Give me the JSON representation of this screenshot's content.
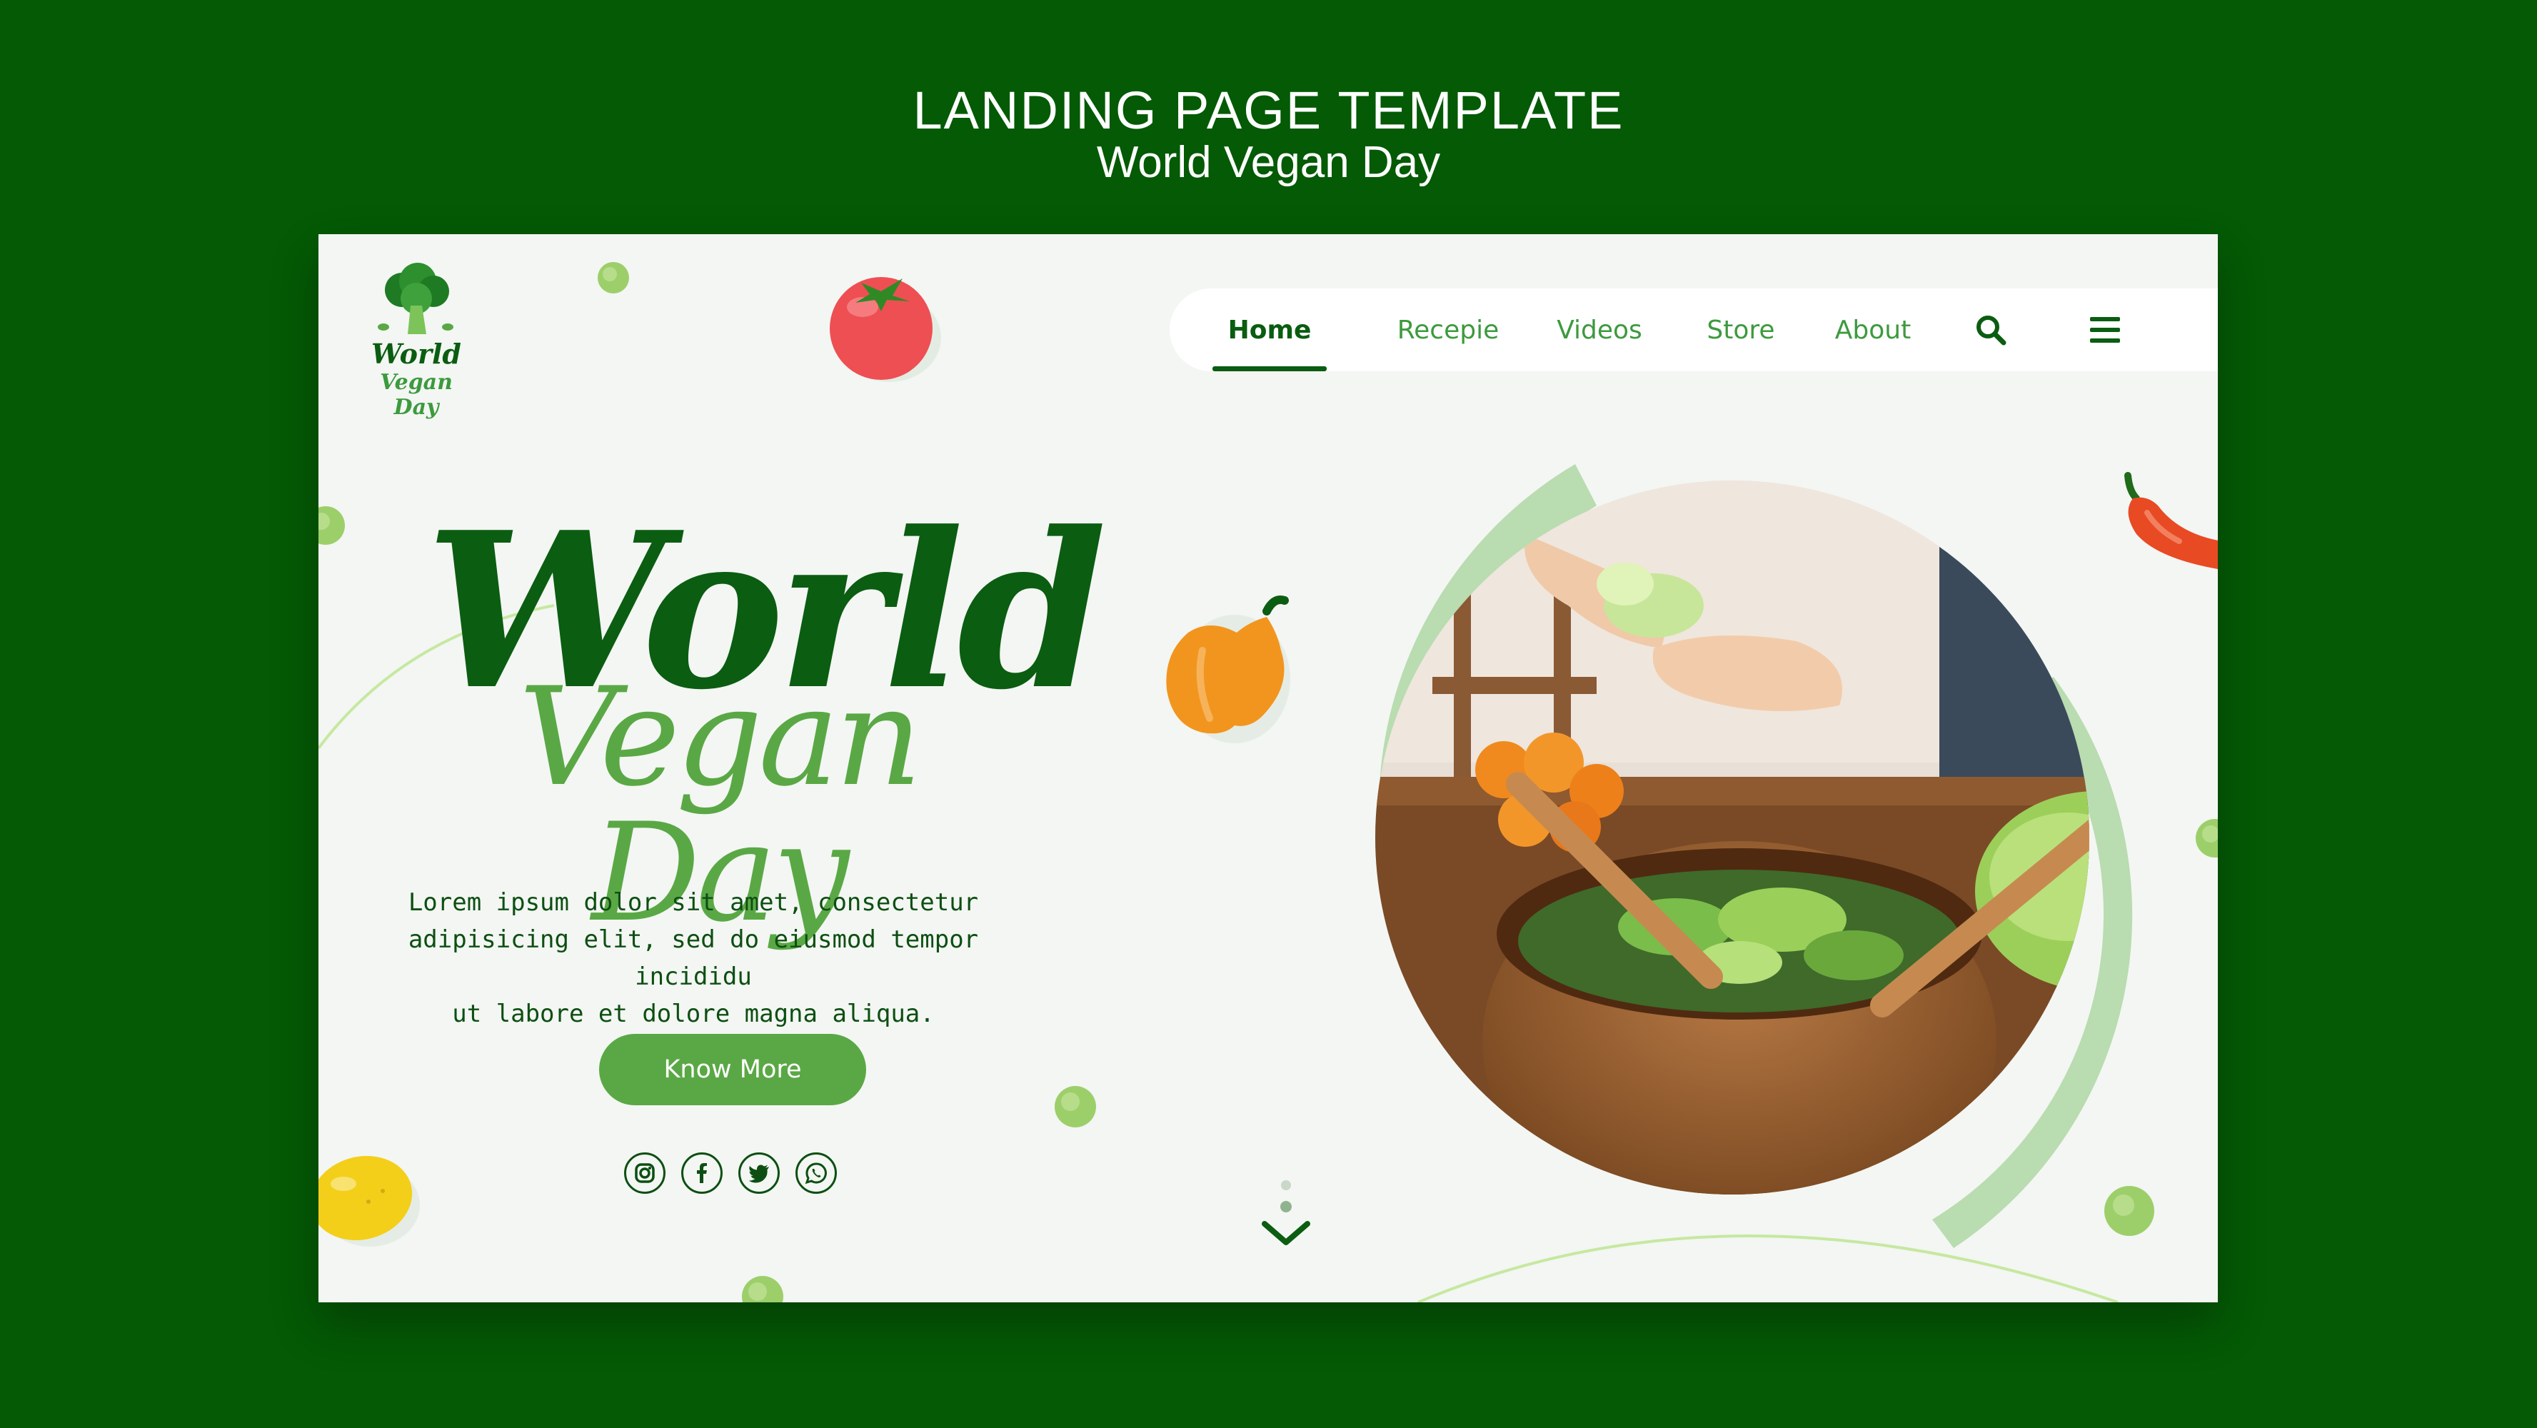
{
  "header": {
    "title": "LANDING PAGE TEMPLATE",
    "subtitle": "World Vegan Day"
  },
  "logo": {
    "line1": "World",
    "line2": "Vegan Day",
    "icon": "broccoli-icon"
  },
  "nav": {
    "items": [
      {
        "label": "Home",
        "active": true
      },
      {
        "label": "Recepie",
        "active": false
      },
      {
        "label": "Videos",
        "active": false
      },
      {
        "label": "Store",
        "active": false
      },
      {
        "label": "About",
        "active": false
      }
    ],
    "search_icon": "search-icon",
    "menu_icon": "hamburger-menu-icon"
  },
  "hero": {
    "title": "World",
    "script": "Vegan Day",
    "body_lines": [
      "Lorem ipsum dolor sit amet, consectetur",
      "adipisicing elit, sed do eiusmod tempor incididu",
      "ut labore et dolore magna aliqua."
    ],
    "cta_label": "Know More",
    "image": "salad-bowl-photo"
  },
  "socials": [
    "instagram-icon",
    "facebook-icon",
    "twitter-icon",
    "whatsapp-icon"
  ],
  "scroll_indicator": "chevron-down-icon",
  "colors": {
    "background": "#045a05",
    "dark_green": "#0b5d11",
    "accent_green": "#5aa845",
    "page_bg": "#f3f6f3"
  }
}
